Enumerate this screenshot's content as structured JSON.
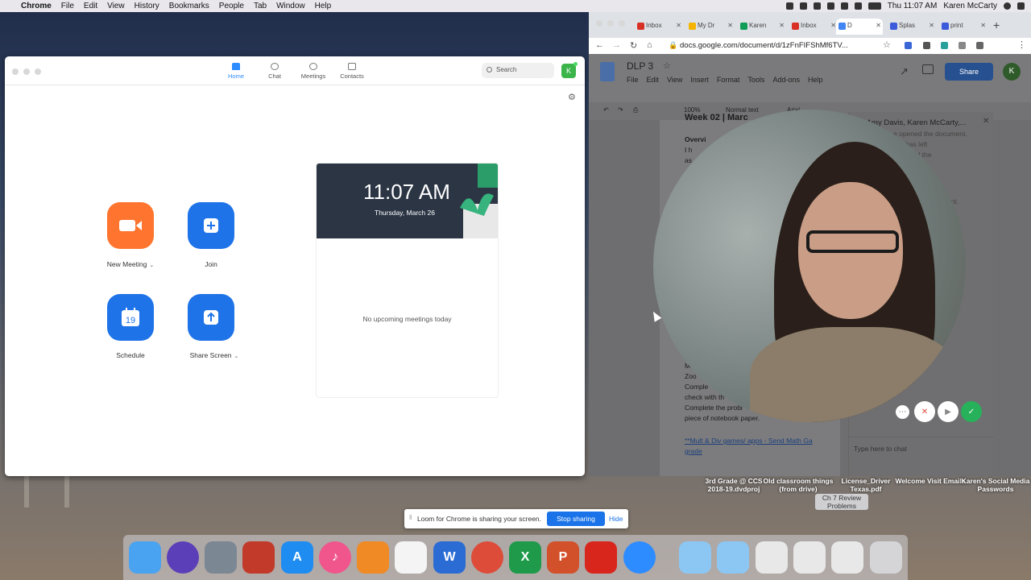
{
  "menubar": {
    "app_name": "Chrome",
    "items": [
      "File",
      "Edit",
      "View",
      "History",
      "Bookmarks",
      "People",
      "Tab",
      "Window",
      "Help"
    ],
    "clock": "Thu 11:07 AM",
    "user": "Karen McCarty"
  },
  "zoom": {
    "tabs": [
      {
        "label": "Home",
        "active": true
      },
      {
        "label": "Chat",
        "active": false
      },
      {
        "label": "Meetings",
        "active": false
      },
      {
        "label": "Contacts",
        "active": false
      }
    ],
    "search_placeholder": "Search",
    "avatar_letter": "K",
    "actions": {
      "new_meeting": "New Meeting",
      "join": "Join",
      "schedule": "Schedule",
      "schedule_day": "19",
      "share_screen": "Share Screen"
    },
    "calendar": {
      "time": "11:07 AM",
      "date": "Thursday, March 26",
      "empty_message": "No upcoming meetings today"
    },
    "colors": {
      "orange": "#ff742e",
      "blue": "#1e73e8",
      "accent": "#2d8cff"
    }
  },
  "chrome": {
    "tabs": [
      {
        "label": "Inbox",
        "icon": "gmail-icon"
      },
      {
        "label": "My Dr",
        "icon": "drive-icon"
      },
      {
        "label": "Karen",
        "icon": "sheets-icon"
      },
      {
        "label": "Inbox",
        "icon": "gmail-icon"
      },
      {
        "label": "D",
        "icon": "docs-icon",
        "active": true
      },
      {
        "label": "Splas",
        "icon": "app-icon"
      },
      {
        "label": "print",
        "icon": "app-icon"
      }
    ],
    "url": "docs.google.com/document/d/1zFnFIFShMf6TV..."
  },
  "doc": {
    "title": "DLP 3",
    "menu": [
      "File",
      "Edit",
      "View",
      "Insert",
      "Format",
      "Tools",
      "Add-ons",
      "Help"
    ],
    "share_label": "Share",
    "user_letter": "K",
    "zoom_level": "100%",
    "style": "Normal text",
    "font": "Arial",
    "heading": "Week 02 | Marc",
    "overview": "Overvi",
    "line1": "I h",
    "line2": "as",
    "body_lines": [
      "M",
      "Zoo",
      "Comple",
      "check with th",
      "Complete the probl",
      "piece of notebook paper."
    ],
    "link_text": "**Mult & Div games/ apps - Send Math Ga",
    "link_text2": "grade",
    "chat_title": "(3) Amy Davis, Karen McCarty,...",
    "chat_lines": [
      "e opened the document.",
      "has left",
      "opened the",
      "ument."
    ],
    "chat_placeholder": "Type here to chat"
  },
  "desktop_files": [
    {
      "label": "3rd Grade @ CCS 2018-19.dvdproj"
    },
    {
      "label": "Old classroom things (from drive)"
    },
    {
      "label": "License_Driver Texas.pdf"
    },
    {
      "label": "Welcome Visit Emails"
    },
    {
      "label": "Karen's Social Media Passwords"
    },
    {
      "label": "Ch 7 Review Problems"
    }
  ],
  "loom": {
    "message": "Loom for Chrome is sharing your screen.",
    "stop_label": "Stop sharing",
    "hide_label": "Hide"
  },
  "dock": [
    {
      "name": "finder-icon",
      "color": "#4aa3f0",
      "glyph": ""
    },
    {
      "name": "siri-icon",
      "color": "#5b3fb8",
      "glyph": ""
    },
    {
      "name": "launchpad-icon",
      "color": "#7c8794",
      "glyph": ""
    },
    {
      "name": "photo-booth-icon",
      "color": "#c23a2a",
      "glyph": ""
    },
    {
      "name": "app-store-icon",
      "color": "#1e8cf0",
      "glyph": "A"
    },
    {
      "name": "itunes-icon",
      "color": "#f0568c",
      "glyph": "♪"
    },
    {
      "name": "ibooks-icon",
      "color": "#f08a24",
      "glyph": ""
    },
    {
      "name": "photos-icon",
      "color": "#f4f4f4",
      "glyph": ""
    },
    {
      "name": "word-icon",
      "color": "#2b6cd4",
      "glyph": "W"
    },
    {
      "name": "chrome-icon",
      "color": "#dd4b39",
      "glyph": ""
    },
    {
      "name": "excel-icon",
      "color": "#1f9a4a",
      "glyph": "X"
    },
    {
      "name": "powerpoint-icon",
      "color": "#d2502a",
      "glyph": "P"
    },
    {
      "name": "acrobat-icon",
      "color": "#d8261c",
      "glyph": ""
    },
    {
      "name": "zoom-icon",
      "color": "#2d8cff",
      "glyph": ""
    },
    {
      "name": "applications-folder-icon",
      "color": "#8cc6f2",
      "glyph": ""
    },
    {
      "name": "documents-folder-icon",
      "color": "#8cc6f2",
      "glyph": ""
    },
    {
      "name": "file-icon",
      "color": "#e8e8e8",
      "glyph": ""
    },
    {
      "name": "file-icon",
      "color": "#e8e8e8",
      "glyph": ""
    },
    {
      "name": "file-icon",
      "color": "#e8e8e8",
      "glyph": ""
    },
    {
      "name": "trash-icon",
      "color": "#d5d5d8",
      "glyph": ""
    }
  ]
}
